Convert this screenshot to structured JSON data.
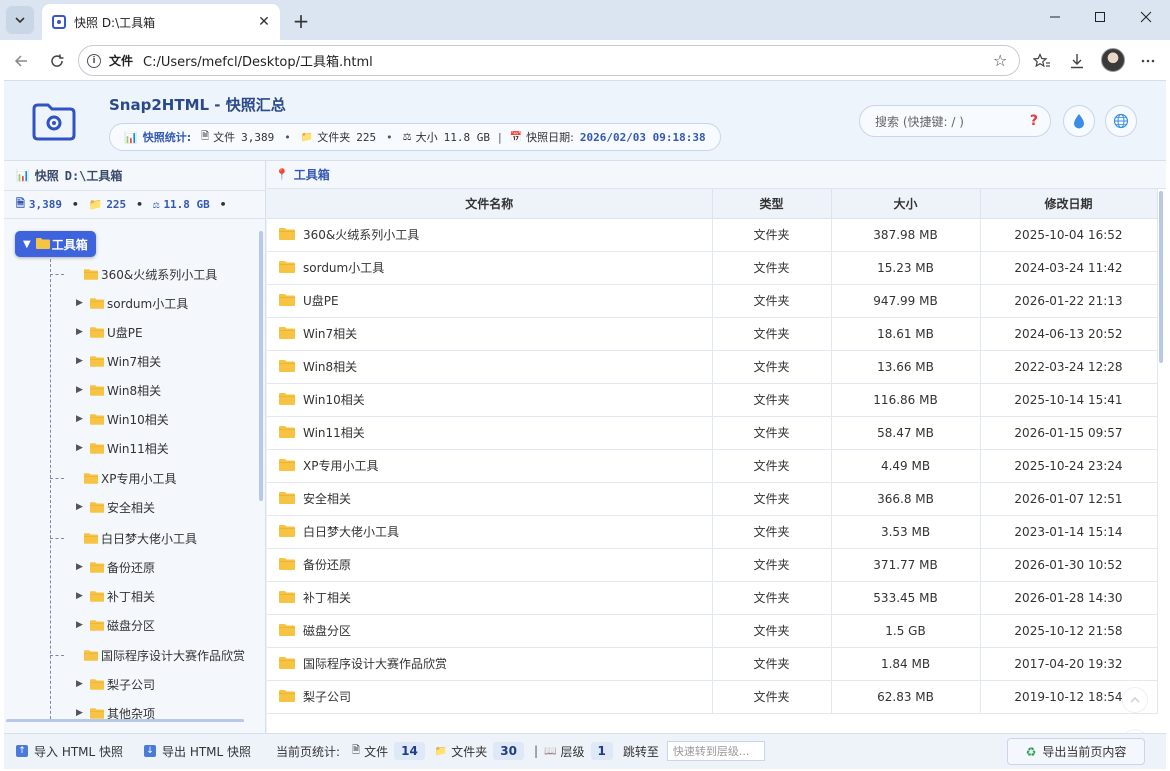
{
  "browser": {
    "tab_title": "快照 D:\\工具箱",
    "url_scheme": "文件",
    "url": "C:/Users/mefcl/Desktop/工具箱.html"
  },
  "header": {
    "app_title": "Snap2HTML - 快照汇总",
    "stats_label": "快照统计:",
    "files_label": "文件",
    "files_count": "3,389",
    "folders_label": "文件夹",
    "folders_count": "225",
    "size_label": "大小",
    "size_value": "11.8 GB",
    "date_label": "快照日期:",
    "date_value": "2026/02/03 09:18:38",
    "search_placeholder": "搜索 (快捷键: / )"
  },
  "sidebar": {
    "title": "快照",
    "path": "D:\\工具箱",
    "files_count": "3,389",
    "folders_count": "225",
    "size_value": "11.8 GB",
    "root_label": "工具箱",
    "items": [
      {
        "label": "360&火绒系列小工具",
        "expandable": false
      },
      {
        "label": "sordum小工具",
        "expandable": true
      },
      {
        "label": "U盘PE",
        "expandable": true
      },
      {
        "label": "Win7相关",
        "expandable": true
      },
      {
        "label": "Win8相关",
        "expandable": true
      },
      {
        "label": "Win10相关",
        "expandable": true
      },
      {
        "label": "Win11相关",
        "expandable": true
      },
      {
        "label": "XP专用小工具",
        "expandable": false
      },
      {
        "label": "安全相关",
        "expandable": true
      },
      {
        "label": "白日梦大佬小工具",
        "expandable": false
      },
      {
        "label": "备份还原",
        "expandable": true
      },
      {
        "label": "补丁相关",
        "expandable": true
      },
      {
        "label": "磁盘分区",
        "expandable": true
      },
      {
        "label": "国际程序设计大赛作品欣赏",
        "expandable": false
      },
      {
        "label": "梨子公司",
        "expandable": true
      },
      {
        "label": "其他杂项",
        "expandable": true
      }
    ]
  },
  "main": {
    "breadcrumb": "工具箱",
    "columns": [
      "文件名称",
      "类型",
      "大小",
      "修改日期"
    ],
    "rows": [
      {
        "name": "360&火绒系列小工具",
        "type": "文件夹",
        "size": "387.98 MB",
        "date": "2025-10-04 16:52"
      },
      {
        "name": "sordum小工具",
        "type": "文件夹",
        "size": "15.23 MB",
        "date": "2024-03-24 11:42"
      },
      {
        "name": "U盘PE",
        "type": "文件夹",
        "size": "947.99 MB",
        "date": "2026-01-22 21:13"
      },
      {
        "name": "Win7相关",
        "type": "文件夹",
        "size": "18.61 MB",
        "date": "2024-06-13 20:52"
      },
      {
        "name": "Win8相关",
        "type": "文件夹",
        "size": "13.66 MB",
        "date": "2022-03-24 12:28"
      },
      {
        "name": "Win10相关",
        "type": "文件夹",
        "size": "116.86 MB",
        "date": "2025-10-14 15:41"
      },
      {
        "name": "Win11相关",
        "type": "文件夹",
        "size": "58.47 MB",
        "date": "2026-01-15 09:57"
      },
      {
        "name": "XP专用小工具",
        "type": "文件夹",
        "size": "4.49 MB",
        "date": "2025-10-24 23:24"
      },
      {
        "name": "安全相关",
        "type": "文件夹",
        "size": "366.8 MB",
        "date": "2026-01-07 12:51"
      },
      {
        "name": "白日梦大佬小工具",
        "type": "文件夹",
        "size": "3.53 MB",
        "date": "2023-01-14 15:14"
      },
      {
        "name": "备份还原",
        "type": "文件夹",
        "size": "371.77 MB",
        "date": "2026-01-30 10:52"
      },
      {
        "name": "补丁相关",
        "type": "文件夹",
        "size": "533.45 MB",
        "date": "2026-01-28 14:30"
      },
      {
        "name": "磁盘分区",
        "type": "文件夹",
        "size": "1.5 GB",
        "date": "2025-10-12 21:58"
      },
      {
        "name": "国际程序设计大赛作品欣赏",
        "type": "文件夹",
        "size": "1.84 MB",
        "date": "2017-04-20 19:32"
      },
      {
        "name": "梨子公司",
        "type": "文件夹",
        "size": "62.83 MB",
        "date": "2019-10-12 18:54"
      }
    ]
  },
  "footer": {
    "import_label": "导入 HTML 快照",
    "export_label": "导出 HTML 快照",
    "page_stats_label": "当前页统计:",
    "files_label": "文件",
    "files_count": "14",
    "folders_label": "文件夹",
    "folders_count": "30",
    "level_label": "层级",
    "level_value": "1",
    "jump_label": "跳转至",
    "jump_placeholder": "快速转到层级...",
    "export_page_label": "导出当前页内容"
  },
  "colors": {
    "accent": "#3d63dd",
    "folder": "#f6c343",
    "header_bg": "#eef4fb"
  }
}
